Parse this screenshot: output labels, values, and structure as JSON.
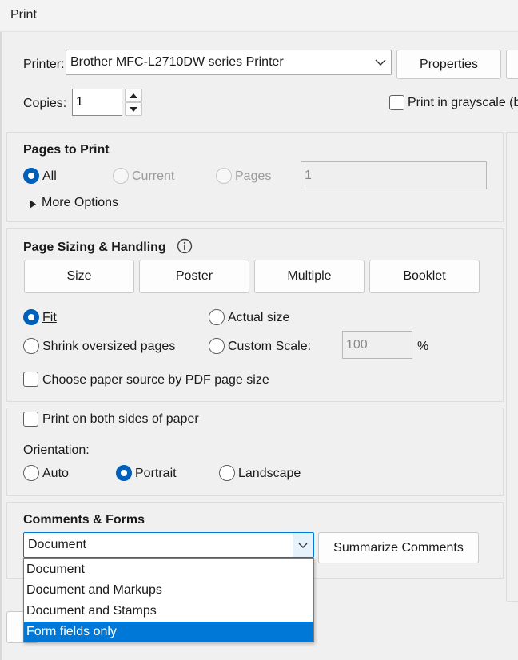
{
  "window": {
    "title": "Print"
  },
  "printer": {
    "label": "Printer:",
    "selected": "Brother MFC-L2710DW series Printer",
    "properties_label": "Properties"
  },
  "copies": {
    "label": "Copies:",
    "value": "1"
  },
  "grayscale": {
    "label": "Print in grayscale (b",
    "checked": false
  },
  "pages_to_print": {
    "heading": "Pages to Print",
    "all_label": "All",
    "current_label": "Current",
    "pages_label": "Pages",
    "pages_value": "1",
    "selected": "All",
    "more_options_label": "More Options"
  },
  "page_sizing": {
    "heading": "Page Sizing & Handling",
    "tabs": [
      "Size",
      "Poster",
      "Multiple",
      "Booklet"
    ],
    "fit_label": "Fit",
    "actual_size_label": "Actual size",
    "shrink_label": "Shrink oversized pages",
    "custom_scale_label": "Custom Scale:",
    "custom_scale_value": "100",
    "percent_label": "%",
    "selected": "Fit",
    "paper_source_label": "Choose paper source by PDF page size",
    "paper_source_checked": false
  },
  "duplex": {
    "both_sides_label": "Print on both sides of paper",
    "both_sides_checked": false,
    "orientation_label": "Orientation:",
    "auto_label": "Auto",
    "portrait_label": "Portrait",
    "landscape_label": "Landscape",
    "selected": "Portrait"
  },
  "comments_forms": {
    "heading": "Comments & Forms",
    "selected": "Document",
    "summarize_label": "Summarize Comments",
    "options": [
      "Document",
      "Document and Markups",
      "Document and Stamps",
      "Form fields only"
    ],
    "highlighted_option": "Form fields only"
  },
  "colors": {
    "accent": "#005fb8",
    "highlight": "#0078d7"
  },
  "icons": {
    "dropdown": "chevron-down-icon",
    "info": "info-icon",
    "expand": "triangle-right-icon"
  }
}
